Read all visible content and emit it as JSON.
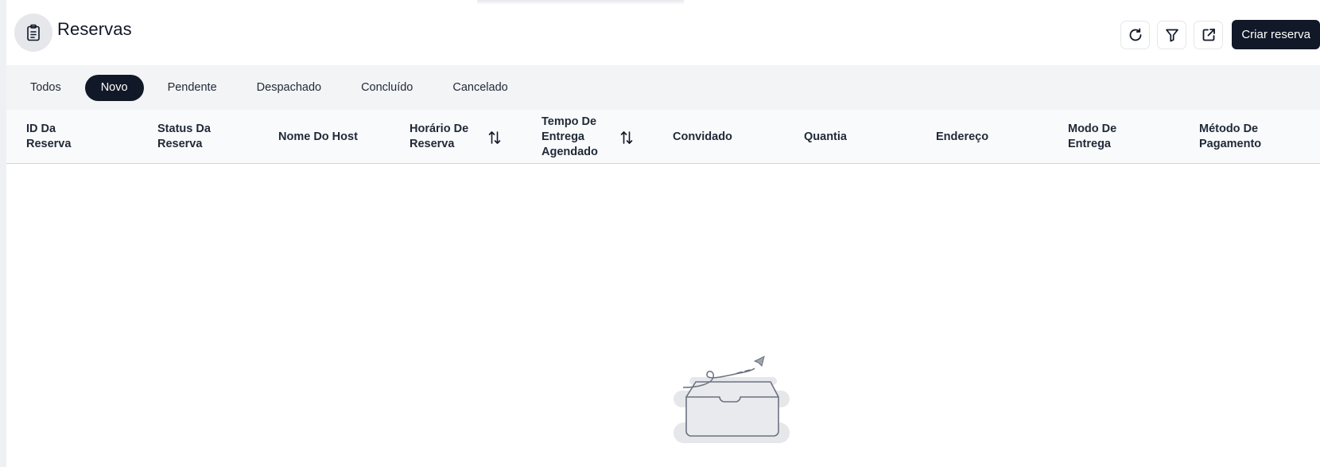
{
  "header": {
    "title": "Reservas",
    "title_icon": "clipboard-icon",
    "actions": [
      {
        "name": "refresh-button",
        "icon": "refresh-icon"
      },
      {
        "name": "filter-button",
        "icon": "filter-icon"
      },
      {
        "name": "open-external-button",
        "icon": "external-link-icon"
      }
    ],
    "create_label": "Criar reserva"
  },
  "tabs": [
    {
      "label": "Todos",
      "active": false
    },
    {
      "label": "Novo",
      "active": true
    },
    {
      "label": "Pendente",
      "active": false
    },
    {
      "label": "Despachado",
      "active": false
    },
    {
      "label": "Concluído",
      "active": false
    },
    {
      "label": "Cancelado",
      "active": false
    }
  ],
  "table": {
    "columns": [
      {
        "label": "ID Da\nReserva",
        "sortable": false
      },
      {
        "label": "Status Da\nReserva",
        "sortable": false
      },
      {
        "label": "Nome Do Host",
        "sortable": false
      },
      {
        "label": "Horário De\nReserva",
        "sortable": true
      },
      {
        "label": "Tempo De\nEntrega\nAgendado",
        "sortable": true
      },
      {
        "label": "Convidado",
        "sortable": false
      },
      {
        "label": "Quantia",
        "sortable": false
      },
      {
        "label": "Endereço",
        "sortable": false
      },
      {
        "label": "Modo De\nEntrega",
        "sortable": false
      },
      {
        "label": "Método De\nPagamento",
        "sortable": false
      }
    ],
    "rows": []
  },
  "empty_state": {
    "illustration": "empty-inbox-icon"
  },
  "colors": {
    "primary": "#111827",
    "tab_bar_bg": "#f3f4f6",
    "title_icon_bg": "#e5e7eb",
    "table_head_bg": "#f9fafb"
  }
}
